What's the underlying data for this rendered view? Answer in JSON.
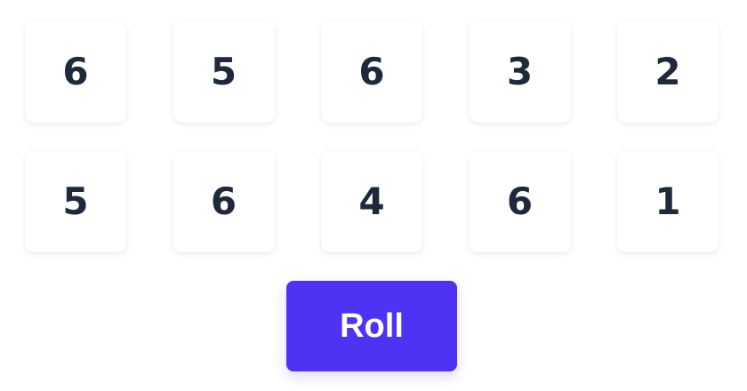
{
  "dice": [
    {
      "value": "6"
    },
    {
      "value": "5"
    },
    {
      "value": "6"
    },
    {
      "value": "3"
    },
    {
      "value": "2"
    },
    {
      "value": "5"
    },
    {
      "value": "6"
    },
    {
      "value": "4"
    },
    {
      "value": "6"
    },
    {
      "value": "1"
    }
  ],
  "controls": {
    "roll_label": "Roll"
  },
  "colors": {
    "accent": "#4f33f5",
    "die_text": "#1e293b",
    "background": "#ffffff"
  }
}
